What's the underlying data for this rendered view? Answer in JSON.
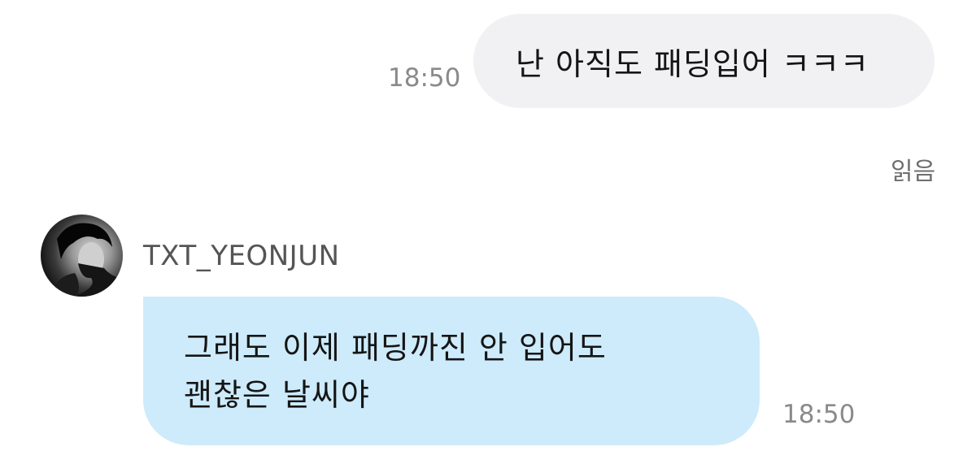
{
  "chat": {
    "outgoing": {
      "text": "난 아직도 패딩입어 ㅋㅋㅋ",
      "time": "18:50",
      "read_status": "읽음"
    },
    "incoming": {
      "sender": "TXT_YEONJUN",
      "lines": [
        "그래도 이제 패딩까진 안 입어도",
        "괜찮은 날씨야"
      ],
      "time": "18:50"
    }
  },
  "colors": {
    "outgoing_bubble": "#f1f1f4",
    "incoming_bubble": "#cdebfb",
    "timestamp": "#8a8a8a"
  }
}
